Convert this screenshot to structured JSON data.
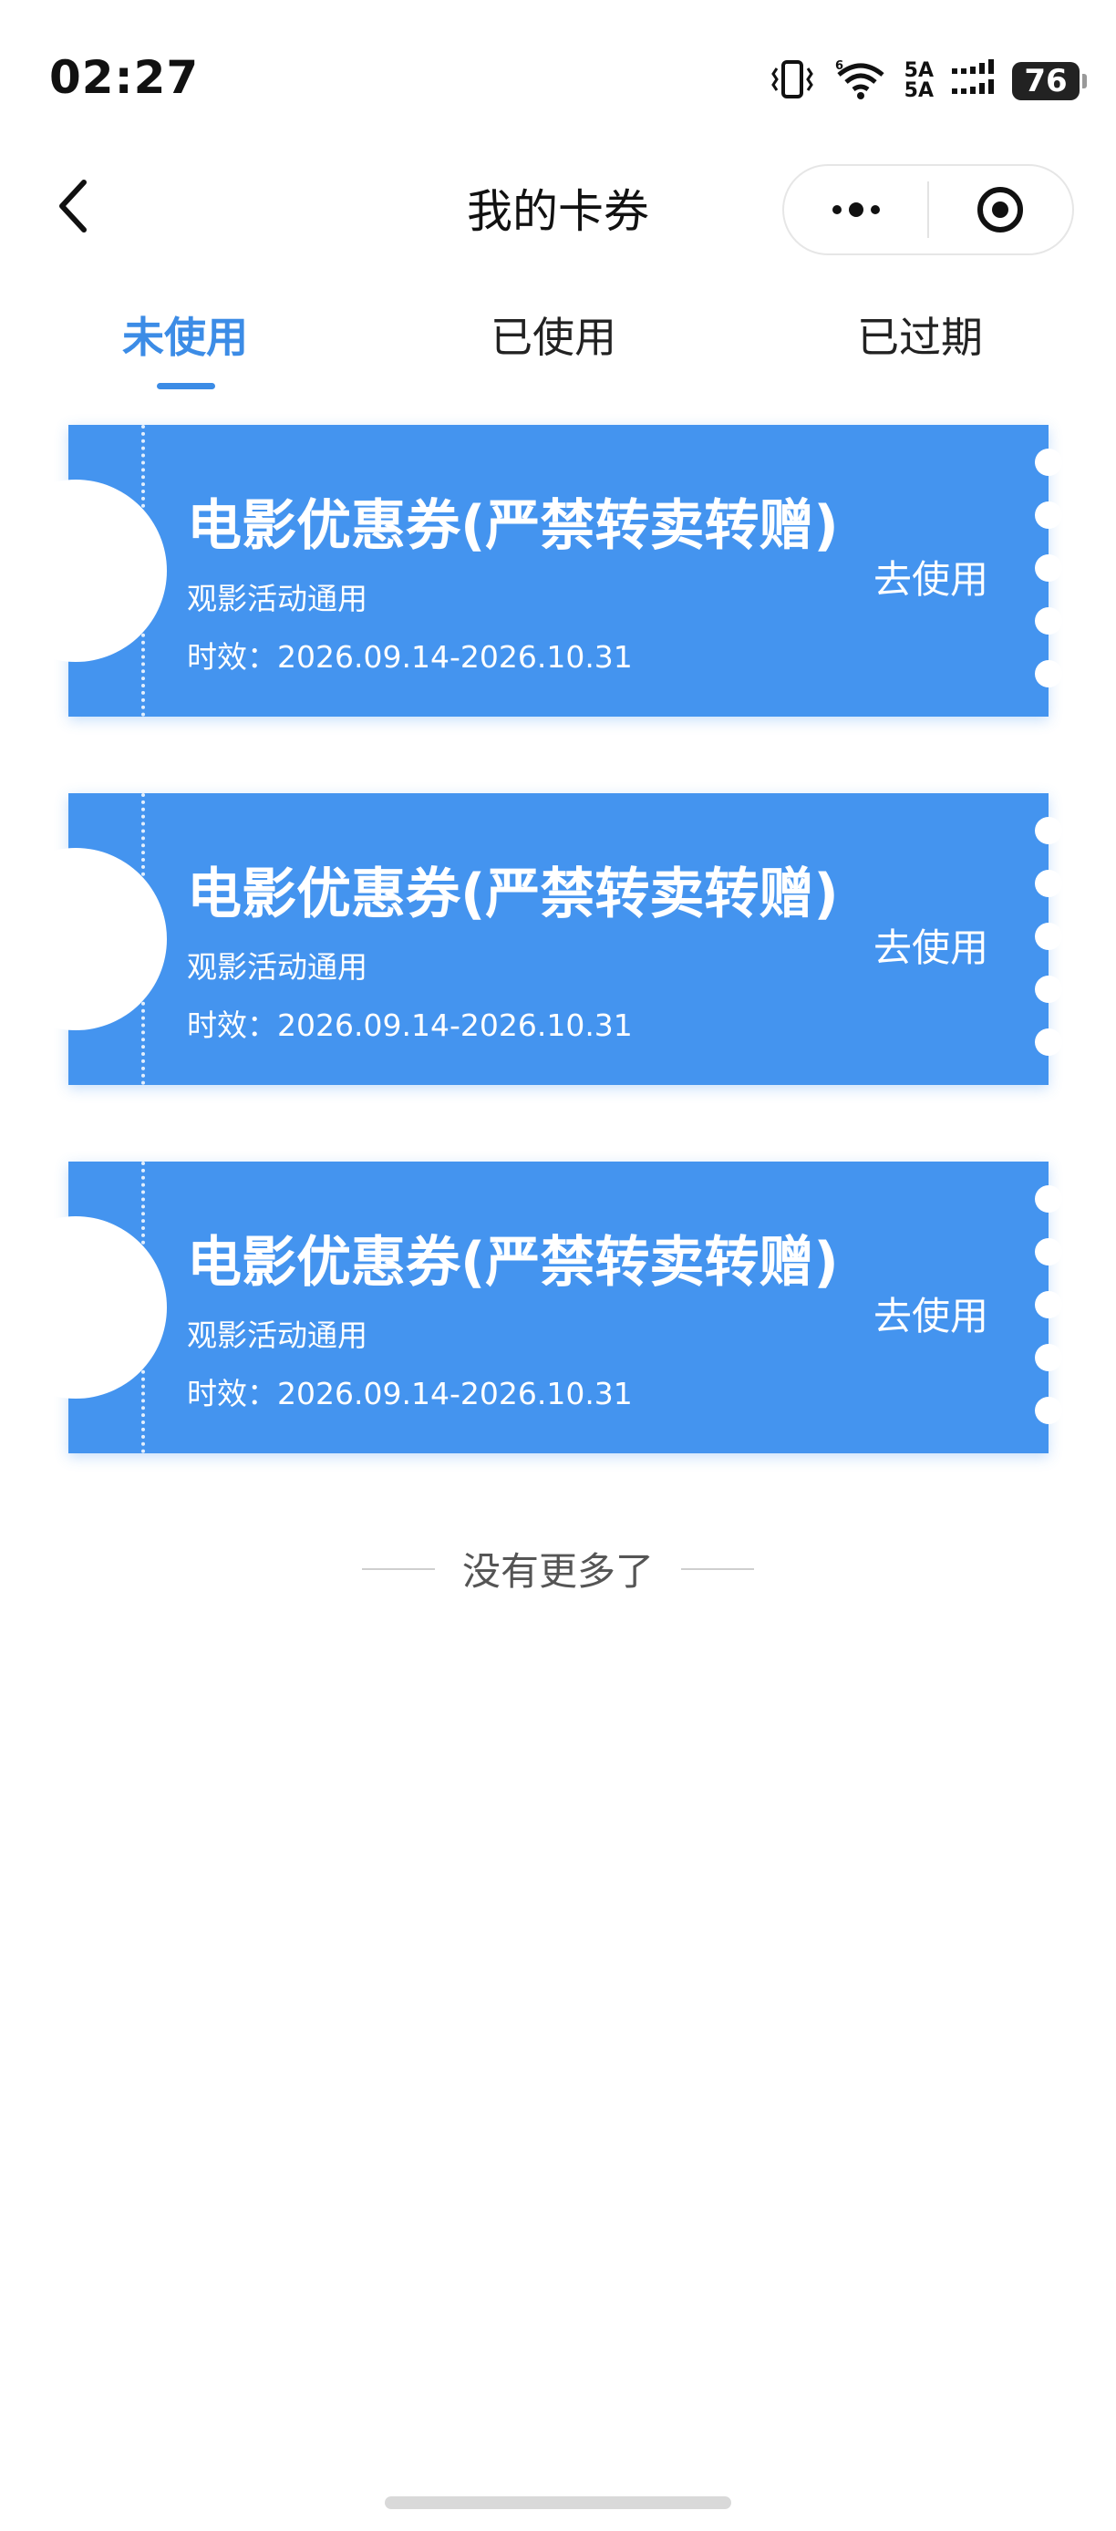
{
  "status_bar": {
    "time": "02:27",
    "network_top": "5A",
    "network_bottom": "5A",
    "battery": "76"
  },
  "nav": {
    "title": "我的卡券"
  },
  "tabs": [
    {
      "label": "未使用",
      "active": true
    },
    {
      "label": "已使用",
      "active": false
    },
    {
      "label": "已过期",
      "active": false
    }
  ],
  "coupons": [
    {
      "title": "电影优惠券(严禁转卖转赠)",
      "subtitle": "观影活动通用",
      "validity": "时效：2026.09.14-2026.10.31",
      "action": "去使用"
    },
    {
      "title": "电影优惠券(严禁转卖转赠)",
      "subtitle": "观影活动通用",
      "validity": "时效：2026.09.14-2026.10.31",
      "action": "去使用"
    },
    {
      "title": "电影优惠券(严禁转卖转赠)",
      "subtitle": "观影活动通用",
      "validity": "时效：2026.09.14-2026.10.31",
      "action": "去使用"
    }
  ],
  "footer": {
    "no_more": "没有更多了"
  },
  "colors": {
    "accent": "#3c8ce6",
    "coupon_bg": "#4494ef"
  },
  "icons": {
    "back": "chevron-left-icon",
    "more": "more-dots-icon",
    "close": "target-circle-icon",
    "vibrate": "vibrate-icon",
    "wifi": "wifi-icon",
    "signal": "signal-icon"
  }
}
